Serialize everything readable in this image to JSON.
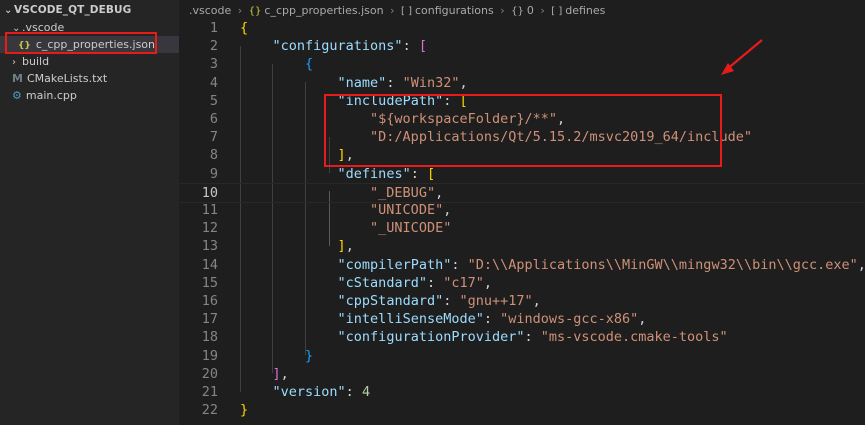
{
  "sidebar": {
    "root": "VSCODE_QT_DEBUG",
    "items": [
      {
        "label": ".vscode",
        "kind": "folder-open"
      },
      {
        "label": "c_cpp_properties.json",
        "kind": "json",
        "icon": "{}"
      },
      {
        "label": "build",
        "kind": "folder-closed"
      },
      {
        "label": "CMakeLists.txt",
        "kind": "cmake",
        "icon": "M"
      },
      {
        "label": "main.cpp",
        "kind": "cpp",
        "icon": "G"
      }
    ]
  },
  "breadcrumb": [
    {
      "label": ".vscode",
      "icon": ""
    },
    {
      "label": "c_cpp_properties.json",
      "icon": "{}"
    },
    {
      "label": "configurations",
      "icon": "[ ]"
    },
    {
      "label": "0",
      "icon": "{}"
    },
    {
      "label": "defines",
      "icon": "[ ]"
    }
  ],
  "editor": {
    "active_line": 10,
    "lines": [
      {
        "n": 1,
        "t": [
          [
            "b1",
            "{"
          ]
        ]
      },
      {
        "n": 2,
        "t": [
          [
            "p",
            "    "
          ],
          [
            "k",
            "\"configurations\""
          ],
          [
            "p",
            ": "
          ],
          [
            "b2",
            "["
          ]
        ]
      },
      {
        "n": 3,
        "t": [
          [
            "p",
            "        "
          ],
          [
            "b3",
            "{"
          ]
        ]
      },
      {
        "n": 4,
        "t": [
          [
            "p",
            "            "
          ],
          [
            "k",
            "\"name\""
          ],
          [
            "p",
            ": "
          ],
          [
            "s",
            "\"Win32\""
          ],
          [
            "p",
            ","
          ]
        ]
      },
      {
        "n": 5,
        "t": [
          [
            "p",
            "            "
          ],
          [
            "k",
            "\"includePath\""
          ],
          [
            "p",
            ": "
          ],
          [
            "b1",
            "["
          ]
        ]
      },
      {
        "n": 6,
        "t": [
          [
            "p",
            "                "
          ],
          [
            "s",
            "\"${workspaceFolder}/**\""
          ],
          [
            "p",
            ","
          ]
        ]
      },
      {
        "n": 7,
        "t": [
          [
            "p",
            "                "
          ],
          [
            "s",
            "\"D:/Applications/Qt/5.15.2/msvc2019_64/include\""
          ]
        ]
      },
      {
        "n": 8,
        "t": [
          [
            "p",
            "            "
          ],
          [
            "b1",
            "]"
          ],
          [
            "p",
            ","
          ]
        ]
      },
      {
        "n": 9,
        "t": [
          [
            "p",
            "            "
          ],
          [
            "k",
            "\"defines\""
          ],
          [
            "p",
            ": "
          ],
          [
            "b1",
            "["
          ]
        ]
      },
      {
        "n": 10,
        "t": [
          [
            "p",
            "                "
          ],
          [
            "s",
            "\"_DEBUG\""
          ],
          [
            "p",
            ","
          ]
        ]
      },
      {
        "n": 11,
        "t": [
          [
            "p",
            "                "
          ],
          [
            "s",
            "\"UNICODE\""
          ],
          [
            "p",
            ","
          ]
        ]
      },
      {
        "n": 12,
        "t": [
          [
            "p",
            "                "
          ],
          [
            "s",
            "\"_UNICODE\""
          ]
        ]
      },
      {
        "n": 13,
        "t": [
          [
            "p",
            "            "
          ],
          [
            "b1",
            "]"
          ],
          [
            "p",
            ","
          ]
        ]
      },
      {
        "n": 14,
        "t": [
          [
            "p",
            "            "
          ],
          [
            "k",
            "\"compilerPath\""
          ],
          [
            "p",
            ": "
          ],
          [
            "s",
            "\"D:\\\\Applications\\\\MinGW\\\\mingw32\\\\bin\\\\gcc.exe\""
          ],
          [
            "p",
            ","
          ]
        ]
      },
      {
        "n": 15,
        "t": [
          [
            "p",
            "            "
          ],
          [
            "k",
            "\"cStandard\""
          ],
          [
            "p",
            ": "
          ],
          [
            "s",
            "\"c17\""
          ],
          [
            "p",
            ","
          ]
        ]
      },
      {
        "n": 16,
        "t": [
          [
            "p",
            "            "
          ],
          [
            "k",
            "\"cppStandard\""
          ],
          [
            "p",
            ": "
          ],
          [
            "s",
            "\"gnu++17\""
          ],
          [
            "p",
            ","
          ]
        ]
      },
      {
        "n": 17,
        "t": [
          [
            "p",
            "            "
          ],
          [
            "k",
            "\"intelliSenseMode\""
          ],
          [
            "p",
            ": "
          ],
          [
            "s",
            "\"windows-gcc-x86\""
          ],
          [
            "p",
            ","
          ]
        ]
      },
      {
        "n": 18,
        "t": [
          [
            "p",
            "            "
          ],
          [
            "k",
            "\"configurationProvider\""
          ],
          [
            "p",
            ": "
          ],
          [
            "s",
            "\"ms-vscode.cmake-tools\""
          ]
        ]
      },
      {
        "n": 19,
        "t": [
          [
            "p",
            "        "
          ],
          [
            "b3",
            "}"
          ]
        ]
      },
      {
        "n": 20,
        "t": [
          [
            "p",
            "    "
          ],
          [
            "b2",
            "]"
          ],
          [
            "p",
            ","
          ]
        ]
      },
      {
        "n": 21,
        "t": [
          [
            "p",
            "    "
          ],
          [
            "k",
            "\"version\""
          ],
          [
            "p",
            ": "
          ],
          [
            "n",
            "4"
          ]
        ]
      },
      {
        "n": 22,
        "t": [
          [
            "b1",
            "}"
          ]
        ]
      }
    ]
  },
  "colors": {
    "annotation_red": "#e81b1b",
    "editor_bg": "#1e1e1e",
    "sidebar_bg": "#252526"
  }
}
